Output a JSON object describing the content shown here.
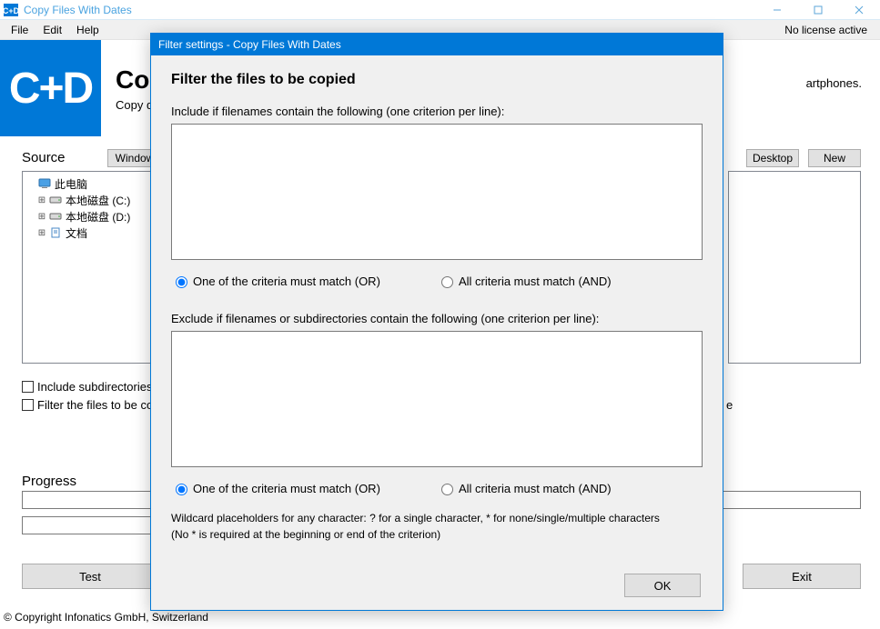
{
  "window": {
    "title": "Copy Files With Dates",
    "license_text": "No license active"
  },
  "menu": {
    "file": "File",
    "edit": "Edit",
    "help": "Help"
  },
  "brand": {
    "logo": "C+D",
    "heading": "Cop",
    "subtitle": "Copy d",
    "right_text": "artphones."
  },
  "sections": {
    "source": "Source",
    "progress": "Progress"
  },
  "buttons": {
    "windows": "Window",
    "desktop": "Desktop",
    "new": "New",
    "test": "Test",
    "exit": "Exit"
  },
  "tree": {
    "root": "此电脑",
    "c_drive": "本地磁盘 (C:)",
    "d_drive": "本地磁盘 (D:)",
    "docs": "文档"
  },
  "checks": {
    "include_sub": "Include subdirectories",
    "filter_files": "Filter the files to be co"
  },
  "truncated": {
    "end_e": "e"
  },
  "footer": {
    "copyright": "© Copyright Infonatics GmbH, Switzerland"
  },
  "dialog": {
    "title": "Filter settings - Copy Files With Dates",
    "heading": "Filter the files to be copied",
    "include_label": "Include if filenames contain the following (one criterion per line):",
    "include_value": "",
    "exclude_label": "Exclude if filenames or subdirectories contain the following (one criterion per line):",
    "exclude_value": "",
    "radio_or": "One of the criteria must match (OR)",
    "radio_and": "All criteria must match (AND)",
    "hint1": "Wildcard placeholders for any character: ? for a single character, * for none/single/multiple characters",
    "hint2": "(No * is required at the beginning or end of the criterion)",
    "ok": "OK"
  }
}
